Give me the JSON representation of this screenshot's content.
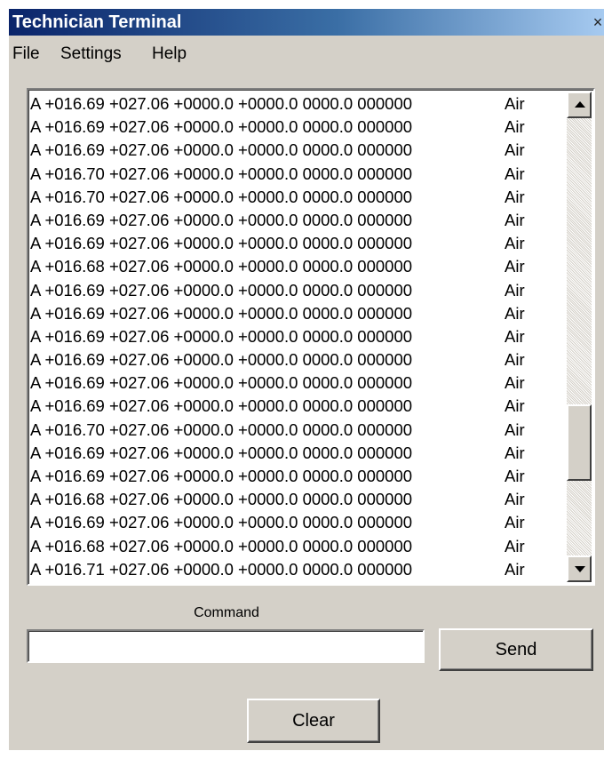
{
  "window": {
    "title": "Technician Terminal",
    "close_glyph": "×",
    "colors": {
      "titlebar_start": "#0a246a",
      "titlebar_end": "#a6caf0",
      "face": "#d4d0c8"
    }
  },
  "menu": {
    "items": [
      "File",
      "Settings",
      "Help"
    ]
  },
  "log": {
    "lines": [
      {
        "reading": "A +016.69 +027.06 +0000.0 +0000.0 0000.0 000000",
        "medium": "Air"
      },
      {
        "reading": "A +016.69 +027.06 +0000.0 +0000.0 0000.0 000000",
        "medium": "Air"
      },
      {
        "reading": "A +016.69 +027.06 +0000.0 +0000.0 0000.0 000000",
        "medium": "Air"
      },
      {
        "reading": "A +016.70 +027.06 +0000.0 +0000.0 0000.0 000000",
        "medium": "Air"
      },
      {
        "reading": "A +016.70 +027.06 +0000.0 +0000.0 0000.0 000000",
        "medium": "Air"
      },
      {
        "reading": "A +016.69 +027.06 +0000.0 +0000.0 0000.0 000000",
        "medium": "Air"
      },
      {
        "reading": "A +016.69 +027.06 +0000.0 +0000.0 0000.0 000000",
        "medium": "Air"
      },
      {
        "reading": "A +016.68 +027.06 +0000.0 +0000.0 0000.0 000000",
        "medium": "Air"
      },
      {
        "reading": "A +016.69 +027.06 +0000.0 +0000.0 0000.0 000000",
        "medium": "Air"
      },
      {
        "reading": "A +016.69 +027.06 +0000.0 +0000.0 0000.0 000000",
        "medium": "Air"
      },
      {
        "reading": "A +016.69 +027.06 +0000.0 +0000.0 0000.0 000000",
        "medium": "Air"
      },
      {
        "reading": "A +016.69 +027.06 +0000.0 +0000.0 0000.0 000000",
        "medium": "Air"
      },
      {
        "reading": "A +016.69 +027.06 +0000.0 +0000.0 0000.0 000000",
        "medium": "Air"
      },
      {
        "reading": "A +016.69 +027.06 +0000.0 +0000.0 0000.0 000000",
        "medium": "Air"
      },
      {
        "reading": "A +016.70 +027.06 +0000.0 +0000.0 0000.0 000000",
        "medium": "Air"
      },
      {
        "reading": "A +016.69 +027.06 +0000.0 +0000.0 0000.0 000000",
        "medium": "Air"
      },
      {
        "reading": "A +016.69 +027.06 +0000.0 +0000.0 0000.0 000000",
        "medium": "Air"
      },
      {
        "reading": "A +016.68 +027.06 +0000.0 +0000.0 0000.0 000000",
        "medium": "Air"
      },
      {
        "reading": "A +016.69 +027.06 +0000.0 +0000.0 0000.0 000000",
        "medium": "Air"
      },
      {
        "reading": "A +016.68 +027.06 +0000.0 +0000.0 0000.0 000000",
        "medium": "Air"
      },
      {
        "reading": "A +016.71 +027.06 +0000.0 +0000.0 0000.0 000000",
        "medium": "Air"
      }
    ],
    "scrollbar": {
      "up_icon": "scroll-up-arrow-icon",
      "down_icon": "scroll-down-arrow-icon"
    }
  },
  "command": {
    "label": "Command",
    "value": "",
    "placeholder": "",
    "send_label": "Send"
  },
  "actions": {
    "clear_label": "Clear"
  }
}
